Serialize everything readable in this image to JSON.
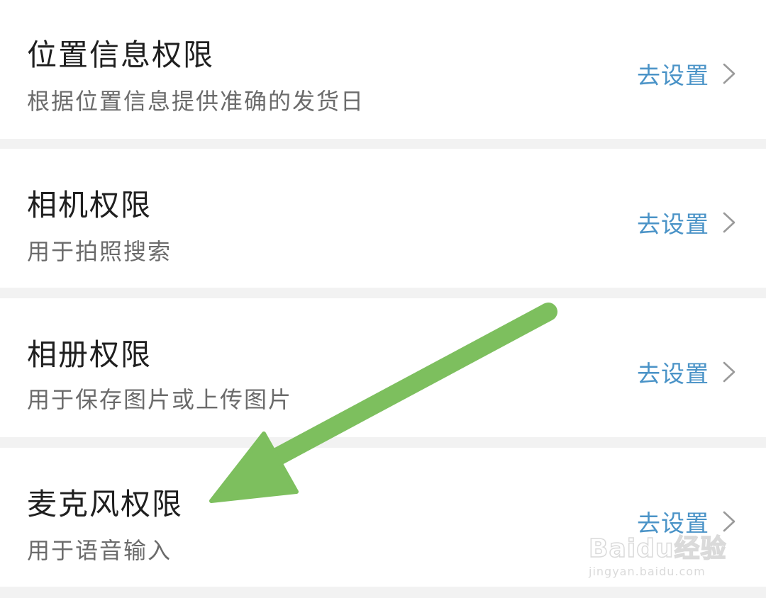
{
  "permissions": [
    {
      "title": "位置信息权限",
      "description": "根据位置信息提供准确的发货日",
      "action_label": "去设置"
    },
    {
      "title": "相机权限",
      "description": "用于拍照搜索",
      "action_label": "去设置"
    },
    {
      "title": "相册权限",
      "description": "用于保存图片或上传图片",
      "action_label": "去设置"
    },
    {
      "title": "麦克风权限",
      "description": "用于语音输入",
      "action_label": "去设置"
    }
  ],
  "watermark": {
    "main": "Baidu经验",
    "sub": "jingyan.baidu.com"
  },
  "colors": {
    "background": "#f2f2f2",
    "card": "#ffffff",
    "title": "#1f1f1f",
    "description": "#6b6b6b",
    "action": "#4a93c7",
    "chevron": "#9a9a9a",
    "annotation_arrow": "#7dbf5e"
  },
  "icons": {
    "action_chevron": "chevron-right-icon",
    "annotation": "green-arrow-icon"
  }
}
